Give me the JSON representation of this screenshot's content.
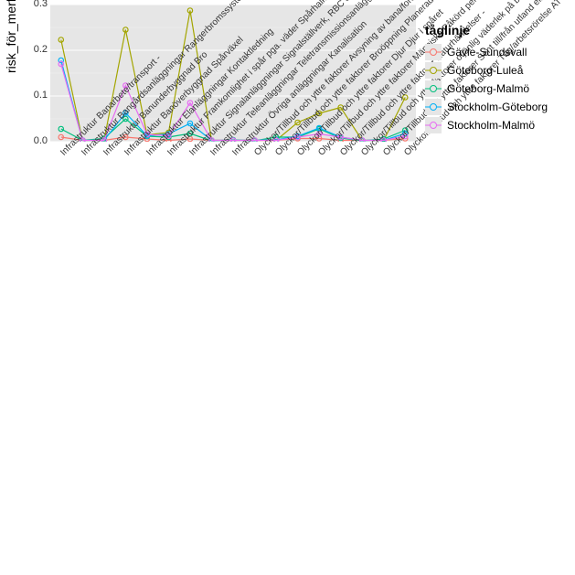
{
  "chart_data": {
    "type": "line",
    "ylabel": "risk_för_merförsening",
    "xlabel": "",
    "legend_title": "tåglinje",
    "ylim": [
      0,
      0.3
    ],
    "yticks": [
      0.0,
      0.1,
      0.2,
      0.3
    ],
    "categories": [
      "Infrastruktur Banarbete/transport -",
      "Infrastruktur Bangårdsanläggningar Rangerbromssystem",
      "Infrastruktur Banunderbyggnad Bro",
      "Infrastruktur Banöverbyggnad Spårväxel",
      "Infrastruktur Elanläggningar Kontaktledning",
      "Infrastruktur Framkomlighet i spår pga. väder Spårhalka",
      "Infrastruktur Signalanläggningar Signalställverk, RBC och linjeblockeringssystem",
      "Infrastruktur Teleanläggningar Teletransmissionsanläggning",
      "Infrastruktur Övriga anläggningar Kanalisation",
      "Olyckor/Tillbud och yttre faktorer Avsyning av bana/fordon Fordon",
      "Olyckor/Tillbud och yttre faktorer Broöppning Planerad broöppningstid",
      "Olyckor/Tillbud och yttre faktorer Djur Djur i spåret",
      "Olyckor/Tillbud och yttre faktorer Människa Påkörd person",
      "Olyckor/Tillbud och yttre faktorer Naturhändelser -",
      "Olyckor/Tillbud och yttre faktorer otjänlig väderlek på bangård -",
      "Olyckor/Tillbud och yttre faktorer Sent till/från utland eller annan infrastrukturförvaltare -",
      "Olyckor/Tillbud och yttre faktorer Tåg/arbetsrörelse ATC-nödbroms"
    ],
    "series": [
      {
        "name": "Gävle-Sundsvall",
        "color": "#F8766D",
        "values": [
          0.01,
          0.003,
          0.003,
          0.01,
          0.006,
          0.003,
          0.006,
          0.003,
          0.003,
          0.003,
          0.003,
          0.007,
          0.007,
          0.003,
          0.003,
          0.003,
          0.007
        ]
      },
      {
        "name": "Göteborg-Luleå",
        "color": "#A3A500",
        "values": [
          0.223,
          0.003,
          0.003,
          0.245,
          0.015,
          0.02,
          0.287,
          0.003,
          0.003,
          0.003,
          0.003,
          0.042,
          0.062,
          0.075,
          0.003,
          0.003,
          0.097
        ]
      },
      {
        "name": "Göteborg-Malmö",
        "color": "#00BF7D",
        "values": [
          0.028,
          0.003,
          0.007,
          0.05,
          0.012,
          0.01,
          0.018,
          0.002,
          0.004,
          0.002,
          0.01,
          0.01,
          0.028,
          0.008,
          0.002,
          0.006,
          0.025
        ]
      },
      {
        "name": "Stockholm-Göteborg",
        "color": "#00B0F6",
        "values": [
          0.178,
          0.003,
          0.003,
          0.063,
          0.013,
          0.017,
          0.04,
          0.003,
          0.003,
          0.003,
          0.004,
          0.012,
          0.03,
          0.01,
          0.003,
          0.003,
          0.018
        ]
      },
      {
        "name": "Stockholm-Malmö",
        "color": "#E76BF3",
        "values": [
          0.17,
          0.003,
          0.003,
          0.123,
          0.016,
          0.013,
          0.085,
          0.003,
          0.003,
          0.003,
          0.003,
          0.01,
          0.017,
          0.01,
          0.003,
          0.003,
          0.012
        ]
      }
    ]
  }
}
